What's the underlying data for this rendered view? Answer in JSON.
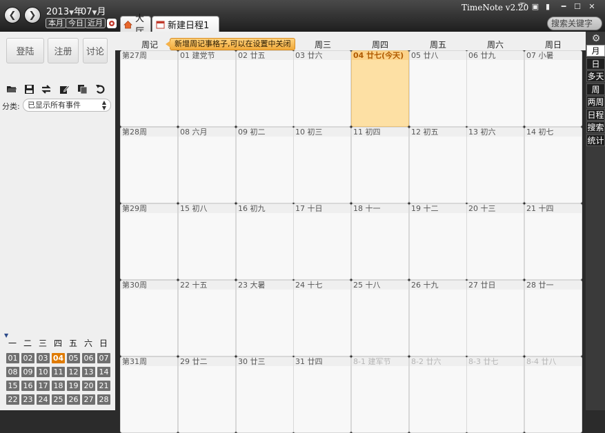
{
  "header": {
    "year": "2013",
    "year_unit": "年",
    "month": "07",
    "month_unit": "月",
    "quick": [
      "本月",
      "今日",
      "近月"
    ],
    "tabs": [
      {
        "label": "大厅"
      },
      {
        "label": "新建日程1"
      }
    ],
    "app_title": "TimeNote v2.20",
    "search_placeholder": "搜索关键字"
  },
  "left": {
    "buttons": [
      "登陆",
      "注册",
      "讨论"
    ],
    "category_label": "分类:",
    "category_value": "已显示所有事件",
    "icons": [
      "open-folder-icon",
      "save-icon",
      "swap-icon",
      "edit-icon",
      "copy-icon",
      "undo-icon"
    ]
  },
  "mini_calendar": {
    "headers": [
      "一",
      "二",
      "三",
      "四",
      "五",
      "六",
      "日"
    ],
    "rows": [
      [
        "01",
        "02",
        "03",
        "04",
        "05",
        "06",
        "07"
      ],
      [
        "08",
        "09",
        "10",
        "11",
        "12",
        "13",
        "14"
      ],
      [
        "15",
        "16",
        "17",
        "18",
        "19",
        "20",
        "21"
      ],
      [
        "22",
        "23",
        "24",
        "25",
        "26",
        "27",
        "28"
      ]
    ],
    "today": "04",
    "today_color": "#e07b00"
  },
  "calendar": {
    "week_header": "周记",
    "days": [
      "周三",
      "周四",
      "周五",
      "周六",
      "周日"
    ],
    "tooltip": "新增周记事格子,可以在设置中关闭",
    "weeks": [
      {
        "label": "第27周",
        "days": [
          "01 建党节",
          "02 廿五",
          "03 廿六",
          "04 廿七(今天)",
          "05 廿八",
          "06 廿九",
          "07 小暑"
        ]
      },
      {
        "label": "第28周",
        "days": [
          "08 六月",
          "09 初二",
          "10 初三",
          "11 初四",
          "12 初五",
          "13 初六",
          "14 初七"
        ]
      },
      {
        "label": "第29周",
        "days": [
          "15 初八",
          "16 初九",
          "17 十日",
          "18 十一",
          "19 十二",
          "20 十三",
          "21 十四"
        ]
      },
      {
        "label": "第30周",
        "days": [
          "22 十五",
          "23 大暑",
          "24 十七",
          "25 十八",
          "26 十九",
          "27 廿日",
          "28 廿一"
        ]
      },
      {
        "label": "第31周",
        "days": [
          "29 廿二",
          "30 廿三",
          "31 廿四",
          "8-1 建军节",
          "8-2 廿六",
          "8-3 廿七",
          "8-4 廿八"
        ]
      }
    ],
    "today_color": "#fde0a4"
  },
  "right": {
    "tabs": [
      "月",
      "日",
      "多天",
      "周",
      "两周",
      "日程",
      "搜索",
      "统计"
    ],
    "active": "月"
  }
}
